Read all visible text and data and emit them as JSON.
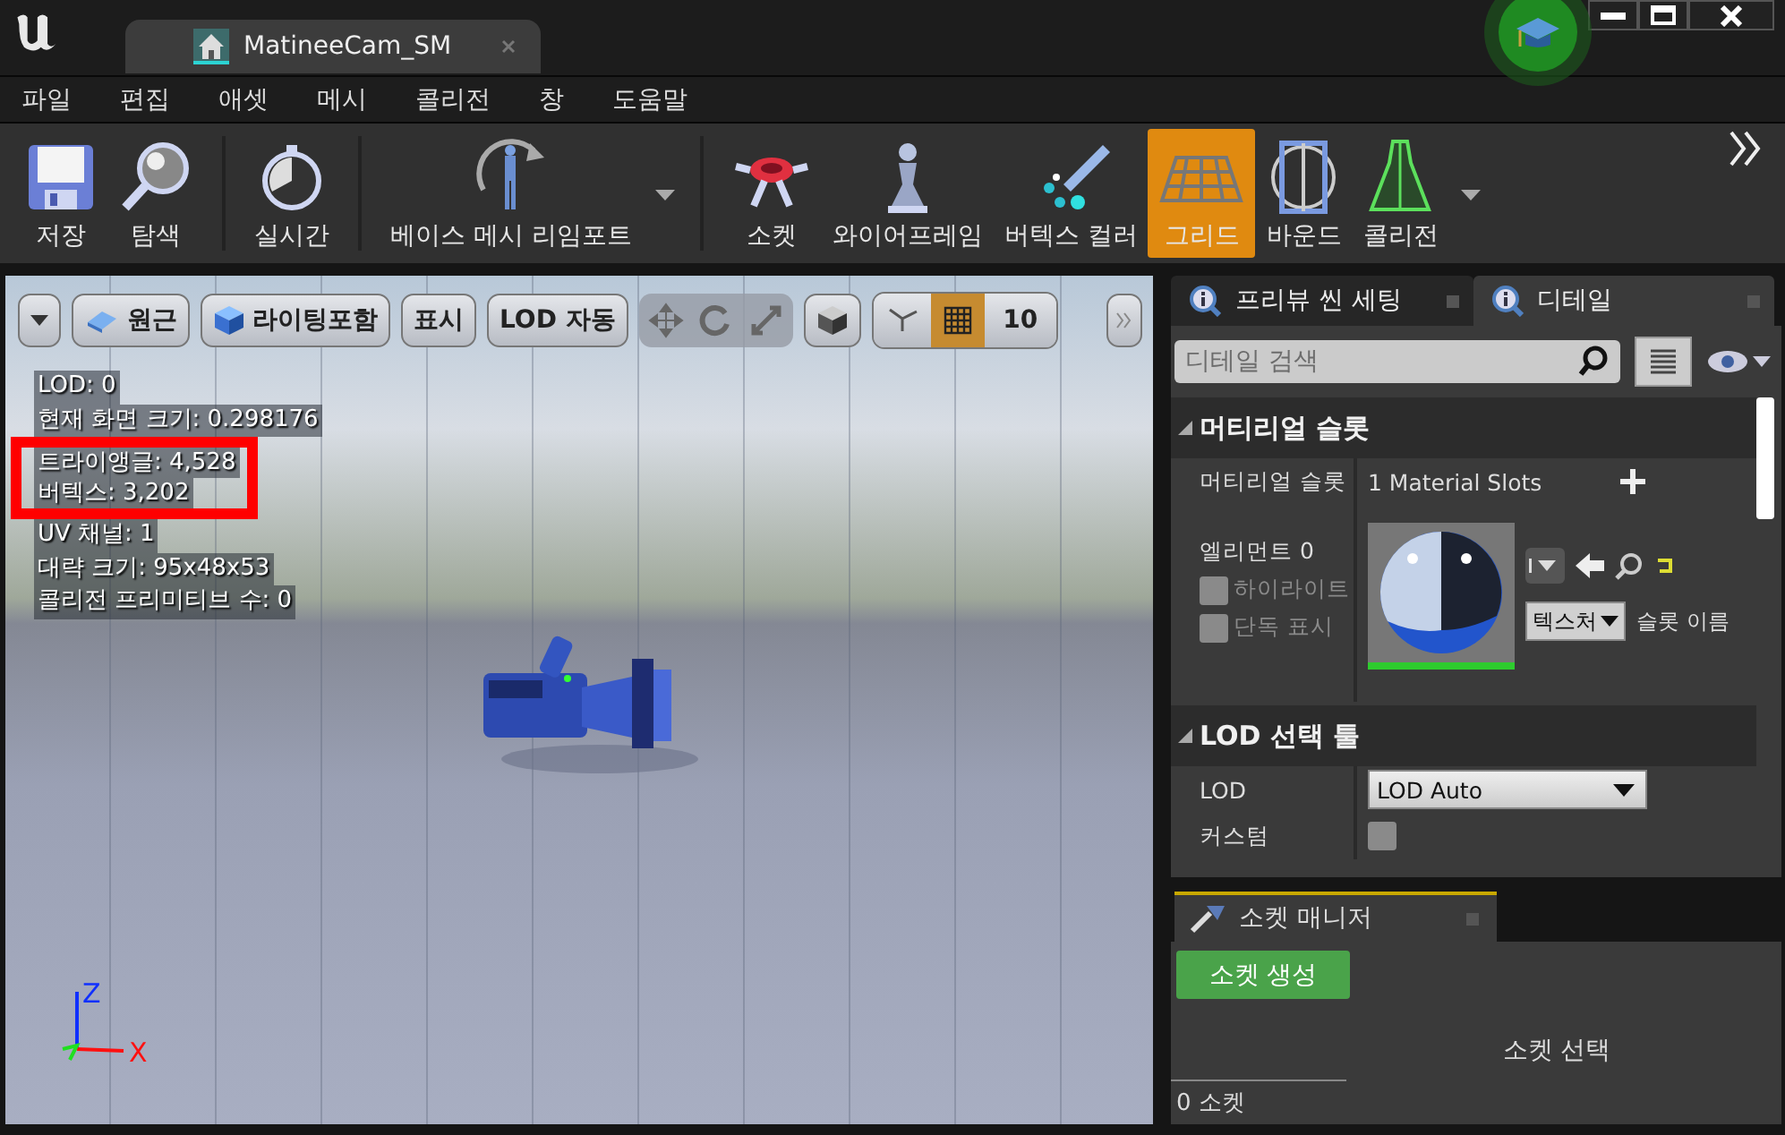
{
  "window": {
    "title": "MatineeCam_SM"
  },
  "menu": [
    "파일",
    "편집",
    "애셋",
    "메시",
    "콜리전",
    "창",
    "도움말"
  ],
  "toolbar_groups": [
    [
      {
        "label": "저장",
        "kind": "button",
        "selected": false
      },
      {
        "label": "탐색",
        "kind": "button",
        "selected": false
      }
    ],
    [
      {
        "label": "실시간",
        "kind": "button",
        "selected": false
      }
    ],
    [
      {
        "label": "베이스 메시 리임포트",
        "kind": "dropdown",
        "selected": false
      }
    ],
    [
      {
        "label": "소켓",
        "kind": "button",
        "selected": false
      },
      {
        "label": "와이어프레임",
        "kind": "button",
        "selected": false
      },
      {
        "label": "버텍스 컬러",
        "kind": "button",
        "selected": false
      },
      {
        "label": "그리드",
        "kind": "button",
        "selected": true
      },
      {
        "label": "바운드",
        "kind": "button",
        "selected": false
      },
      {
        "label": "콜리전",
        "kind": "dropdown",
        "selected": false
      }
    ]
  ],
  "viewport": {
    "buttons": [
      {
        "label": "원근"
      },
      {
        "label": "라이팅포함"
      },
      {
        "label": "표시"
      },
      {
        "label": "LOD 자동"
      }
    ],
    "grid_snap": {
      "on": true,
      "value": "10"
    },
    "stats": [
      {
        "text": "LOD:  0",
        "highlighted": false
      },
      {
        "text": "현재 화면 크기: 0.298176",
        "highlighted": false
      },
      {
        "text": "트라이앵글: 4,528",
        "highlighted": true
      },
      {
        "text": "버텍스: 3,202",
        "highlighted": true
      },
      {
        "text": "UV 채널:  1",
        "highlighted": false
      },
      {
        "text": "대략 크기: 95x48x53",
        "highlighted": false
      },
      {
        "text": "콜리전 프리미티브 수: 0",
        "highlighted": false
      }
    ],
    "axes": {
      "z": "Z",
      "x": "X"
    }
  },
  "details": {
    "tabs": [
      {
        "label": "프리뷰 씬 세팅",
        "selected": false
      },
      {
        "label": "디테일",
        "selected": true
      }
    ],
    "search": {
      "placeholder": "디테일 검색"
    },
    "material_section": {
      "title": "머티리얼 슬롯",
      "slots_label": "머티리얼 슬롯",
      "slots_value": "1 Material Slots",
      "element_label": "엘리먼트 0",
      "checks": [
        {
          "label": "하이라이트",
          "checked": false
        },
        {
          "label": "단독 표시",
          "checked": false
        }
      ],
      "texture_dropdown": "텍스처",
      "slot_name_label": "슬롯 이름"
    },
    "lod_section": {
      "title": "LOD 선택 툴",
      "lod_label": "LOD",
      "lod_value": "LOD Auto",
      "custom_label": "커스텀",
      "custom_checked": false
    }
  },
  "socket_manager": {
    "tab": "소켓 매니저",
    "create_button": "소켓 생성",
    "hint": "소켓 선택",
    "count": "0 소켓"
  }
}
